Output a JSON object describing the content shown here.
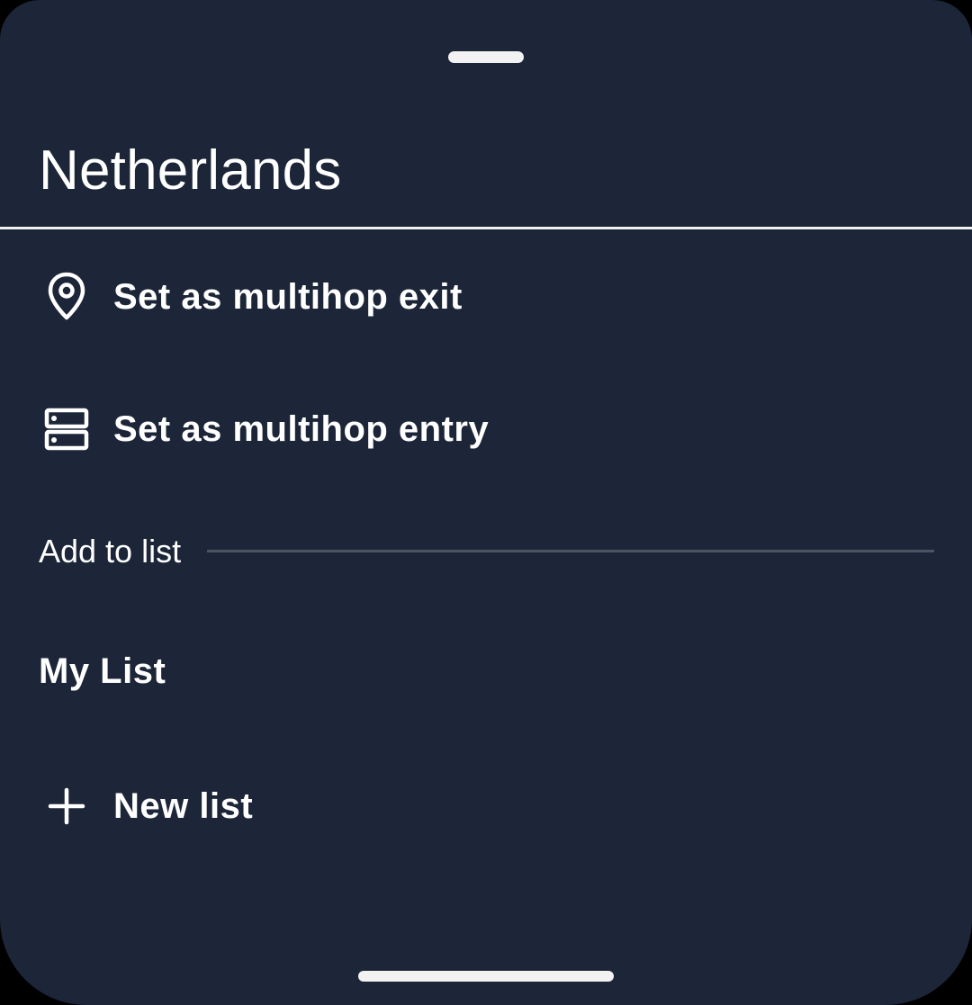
{
  "sheet": {
    "title": "Netherlands",
    "actions": [
      {
        "label": "Set as multihop exit",
        "icon": "location-pin-icon"
      },
      {
        "label": "Set as multihop entry",
        "icon": "server-icon"
      }
    ],
    "section_header": "Add to list",
    "lists": [
      {
        "label": "My List"
      }
    ],
    "new_list": {
      "label": "New list",
      "icon": "plus-icon"
    }
  },
  "colors": {
    "background": "#1c2638",
    "text": "#ffffff",
    "divider": "#4a5563"
  }
}
